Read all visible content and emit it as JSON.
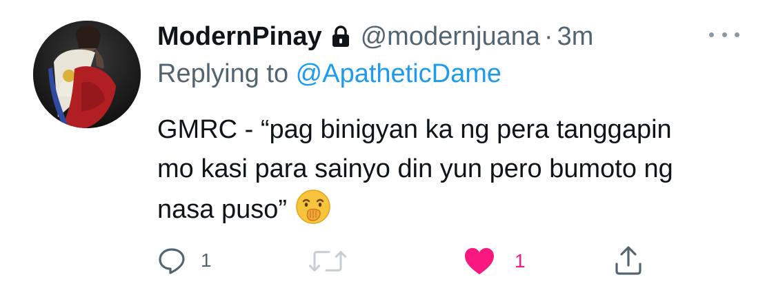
{
  "tweet": {
    "display_name": "ModernPinay",
    "handle": "@modernjuana",
    "separator": "·",
    "time": "3m",
    "replying_prefix": "Replying to ",
    "replying_to": "@ApatheticDame",
    "text": "GMRC - “pag binigyan ka ng pera tanggapin mo kasi para sainyo din yun pero bumoto ng nasa puso”",
    "emoji": "face-with-hand-over-mouth"
  },
  "actions": {
    "reply_count": "1",
    "like_count": "1",
    "liked": true
  },
  "colors": {
    "text": "#0f1419",
    "muted": "#536471",
    "link": "#1d9bf0",
    "like": "#f91880",
    "icon_muted": "#8b98a5"
  },
  "icons": [
    "lock-icon",
    "more-icon",
    "reply-icon",
    "retweet-icon",
    "heart-icon",
    "share-icon"
  ]
}
